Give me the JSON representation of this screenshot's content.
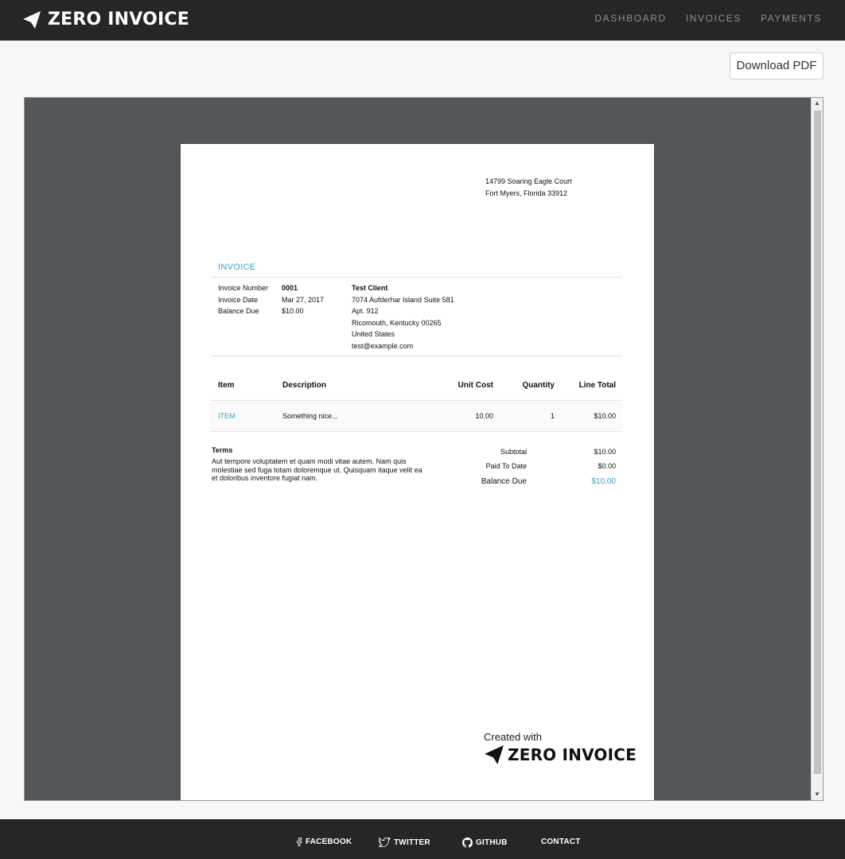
{
  "header": {
    "brand": "ZERO INVOICE",
    "nav": [
      "DASHBOARD",
      "INVOICES",
      "PAYMENTS"
    ]
  },
  "actions": {
    "download_label": "Download PDF"
  },
  "invoice": {
    "from_address": [
      "14799 Soaring Eagle Court",
      "Fort Myers, Florida 33912"
    ],
    "title": "INVOICE",
    "meta": [
      {
        "label": "Invoice Number",
        "value": "0001"
      },
      {
        "label": "Invoice Date",
        "value": "Mar 27, 2017"
      },
      {
        "label": "Balance Due",
        "value": "$10.00"
      }
    ],
    "client": {
      "name": "Test Client",
      "lines": [
        "7074 Aufderhar Island Suite 581",
        "Apt. 912",
        "Ricomouth, Kentucky 00265",
        "United States",
        "test@example.com"
      ]
    },
    "columns": {
      "item": "Item",
      "description": "Description",
      "unit_cost": "Unit Cost",
      "quantity": "Quantity",
      "line_total": "Line Total"
    },
    "items": [
      {
        "item": "ITEM",
        "description": "Something nice...",
        "unit_cost": "10.00",
        "quantity": "1",
        "line_total": "$10.00"
      }
    ],
    "terms_title": "Terms",
    "terms_text": "Aut tempore voluptatem et quam modi vitae autem. Nam quis molestiae sed fuga totam doloremque ut. Quisquam itaque velit ea et doloribus inventore fugiat nam.",
    "totals": [
      {
        "label": "Subtotal",
        "value": "$10.00"
      },
      {
        "label": "Paid To Date",
        "value": "$0.00"
      },
      {
        "label": "Balance Due",
        "value": "$10.00"
      }
    ],
    "created_with": "Created with",
    "footer_brand": "ZERO INVOICE",
    "accent_color": "#3aa0c8"
  },
  "footer": {
    "links": [
      "FACEBOOK",
      "TWITTER",
      "GITHUB",
      "CONTACT"
    ]
  }
}
